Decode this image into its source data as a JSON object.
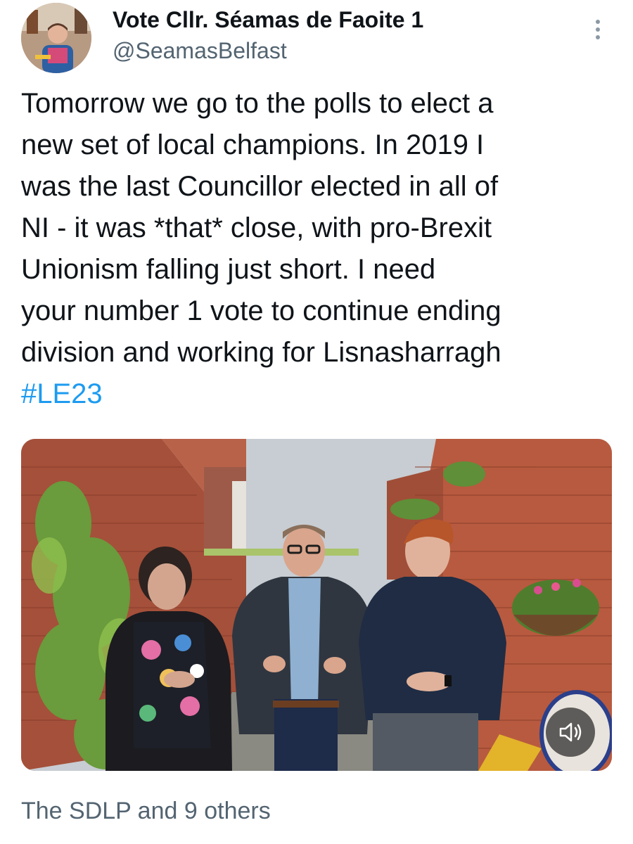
{
  "tweet": {
    "display_name": "Vote Cllr. Séamas de Faoite 1",
    "handle": "@SeamasBelfast",
    "text_lines": [
      "Tomorrow we go to the polls to elect a",
      "new set of local champions. In 2019 I",
      "was the last Councillor elected in all of",
      "NI - it was *that* close, with pro-Brexit",
      "Unionism falling just short. I need",
      "your number 1 vote to continue ending",
      "division and working for Lisnasharragh"
    ],
    "hashtag": "#LE23",
    "liked_by": "The SDLP and 9 others"
  },
  "icons": {
    "more": "more-vertical-icon",
    "mute": "speaker-muted-icon"
  },
  "colors": {
    "link": "#1d9bf0",
    "secondary_text": "#536471",
    "primary_text": "#0f1419"
  }
}
